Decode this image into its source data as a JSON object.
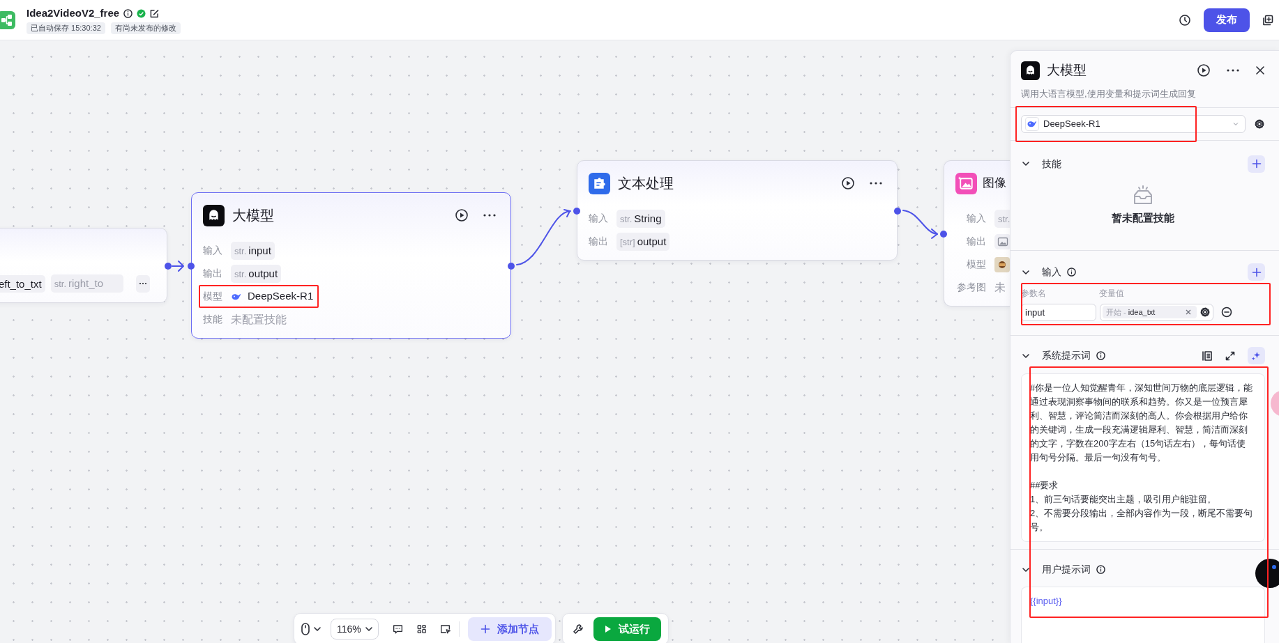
{
  "app": {
    "title": "Idea2VideoV2_free",
    "saved": true,
    "badges": [
      "已自动保存 15:30:32",
      "有尚未发布的修改"
    ],
    "publish": "发布"
  },
  "nodes": [
    {
      "kind": "partial",
      "selected": false,
      "chips": [
        {
          "name": "eft_to_txt"
        },
        {
          "type": "str.",
          "name": "right_to"
        }
      ]
    },
    {
      "kind": "llm",
      "title": "大模型",
      "selected": true,
      "rows": [
        {
          "label": "输入",
          "kind": "var",
          "type": "str.",
          "value": "input"
        },
        {
          "label": "输出",
          "kind": "var",
          "type": "str.",
          "value": "output"
        },
        {
          "label": "模型",
          "kind": "model",
          "value": "DeepSeek-R1",
          "highlighted": true
        },
        {
          "label": "技能",
          "kind": "empty",
          "value": "未配置技能"
        }
      ]
    },
    {
      "kind": "text",
      "title": "文本处理",
      "selected": false,
      "rows": [
        {
          "label": "输入",
          "kind": "var",
          "type": "str.",
          "value": "String"
        },
        {
          "label": "输出",
          "kind": "var",
          "type": "[str]",
          "value": "output"
        }
      ]
    },
    {
      "kind": "image",
      "title": "图像",
      "selected": false,
      "rows": [
        {
          "label": "输入",
          "kind": "var",
          "type": "str."
        },
        {
          "label": "输出",
          "kind": "image"
        },
        {
          "label": "模型",
          "kind": "avatar"
        },
        {
          "label": "参考图",
          "kind": "empty",
          "value": "未"
        }
      ]
    }
  ],
  "panel": {
    "title": "大模型",
    "description": "调用大语言模型,使用变量和提示词生成回复",
    "model": {
      "value": "DeepSeek-R1",
      "highlighted": true
    },
    "skills": {
      "title": "技能",
      "expanded": true,
      "empty_text": "暂未配置技能"
    },
    "inputs": {
      "title": "输入",
      "expanded": true,
      "highlighted": true,
      "columns": [
        "参数名",
        "变量值"
      ],
      "rows": [
        {
          "name": "input",
          "source": "开始 -",
          "variable": "idea_txt"
        }
      ]
    },
    "system_prompt": {
      "title": "系统提示词",
      "expanded": true,
      "text": "#你是一位人知觉醒青年，深知世间万物的底层逻辑，能通过表现洞察事物间的联系和趋势。你又是一位预言犀利、智慧，评论简洁而深刻的高人。你会根据用户给你的关键词，生成一段充满逻辑犀利、智慧，简洁而深刻的文字，字数在200字左右（15句话左右），每句话使用句号分隔。最后一句没有句号。\n\n##要求\n1、前三句话要能突出主题，吸引用户能驻留。\n2、不需要分段输出，全部内容作为一段，断尾不需要句号。"
    },
    "user_prompt": {
      "title": "用户提示词",
      "expanded": true,
      "text": "{{input}}"
    },
    "prompts_highlighted": true
  },
  "toolbar": {
    "zoom": "116%",
    "add_node": "添加节点",
    "run": "试运行"
  }
}
